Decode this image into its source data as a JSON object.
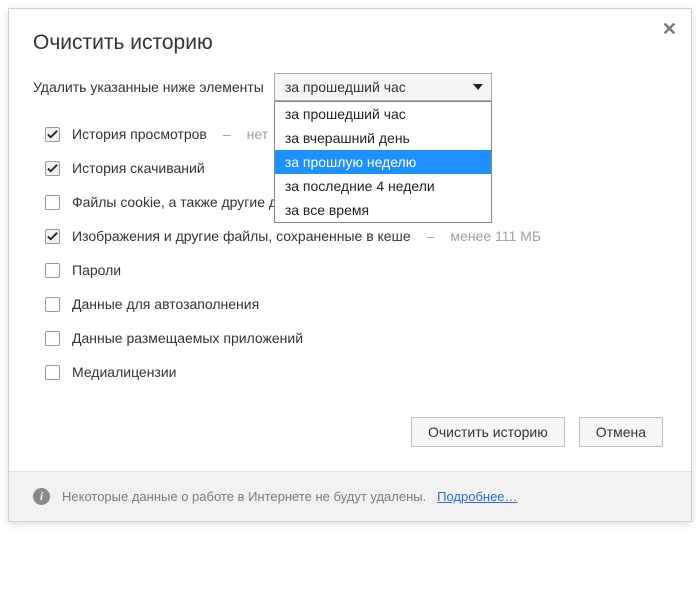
{
  "dialog": {
    "title": "Очистить историю",
    "close_symbol": "✕",
    "time_range_label": "Удалить указанные ниже элементы",
    "combo_selected": "за прошедший час",
    "combo_options": {
      "opt0": "за прошедший час",
      "opt1": "за вчерашний день",
      "opt2": "за прошлую неделю",
      "opt3": "за последние 4 недели",
      "opt4": "за все время"
    },
    "rows": {
      "browsing_history": {
        "label": "История просмотров",
        "hint": "нет"
      },
      "download_history": {
        "label": "История скачиваний"
      },
      "cookies": {
        "label": "Файлы cookie, а также другие данные сайтов и плагинов"
      },
      "cache": {
        "label": "Изображения и другие файлы, сохраненные в кеше",
        "hint": "менее 111 МБ"
      },
      "passwords": {
        "label": "Пароли"
      },
      "autofill": {
        "label": "Данные для автозаполнения"
      },
      "hosted_apps": {
        "label": "Данные размещаемых приложений"
      },
      "media_licenses": {
        "label": "Медиалицензии"
      }
    },
    "buttons": {
      "clear": "Очистить историю",
      "cancel": "Отмена"
    },
    "footer": {
      "text": "Некоторые данные о работе в Интернете не будут удалены.",
      "link": "Подробнее…"
    }
  }
}
